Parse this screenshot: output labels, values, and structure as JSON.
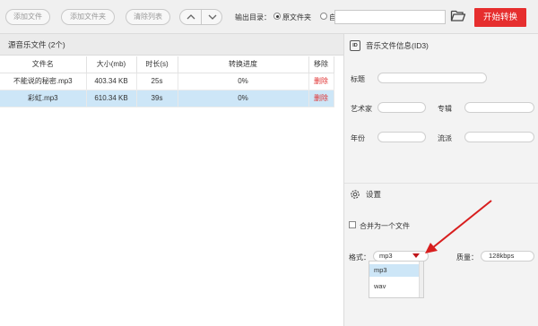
{
  "toolbar": {
    "add_file": "添加文件",
    "add_folder": "添加文件夹",
    "clear_list": "清除列表",
    "output_dir_label": "输出目录：",
    "radio_original": "原文件夹",
    "radio_custom": "自定义",
    "output_path": "",
    "folder_icon": "folder-open-icon",
    "start_button": "开始转换",
    "start_color": "#e62e2e"
  },
  "file_list": {
    "title": "源音乐文件 (2个)",
    "columns": [
      "文件名",
      "大小(mb)",
      "时长(s)",
      "转换进度",
      "移除"
    ],
    "rows": [
      {
        "name": "不能说的秘密.mp3",
        "size": "403.34 KB",
        "duration": "25s",
        "progress": "0%",
        "remove": "删除",
        "selected": false
      },
      {
        "name": "彩虹.mp3",
        "size": "610.34 KB",
        "duration": "39s",
        "progress": "0%",
        "remove": "删除",
        "selected": true
      }
    ],
    "selected_color": "#cde6f7"
  },
  "id3": {
    "icon_text": "ID",
    "title": "音乐文件信息(ID3)",
    "fields": {
      "title_label": "标题",
      "artist_label": "艺术家",
      "album_label": "专辑",
      "year_label": "年份",
      "genre_label": "流派"
    }
  },
  "settings": {
    "icon": "gear-icon",
    "title": "设置",
    "merge_label": "合并为一个文件",
    "merge_checked": false,
    "format_label": "格式：",
    "format_value": "mp3",
    "format_options": [
      "mp3",
      "wav"
    ],
    "highlighted_option": "mp3",
    "quality_label": "质量：",
    "quality_value": "128kbps",
    "annotation_color": "#d81e1e"
  }
}
